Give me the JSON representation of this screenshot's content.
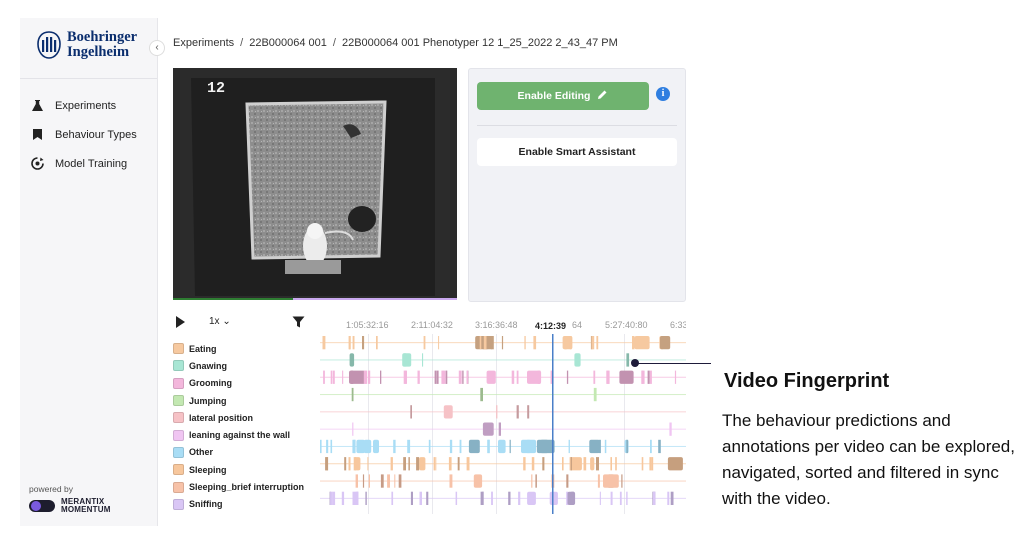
{
  "brand": {
    "name": "Boehringer Ingelheim",
    "line1": "Boehringer",
    "line2": "Ingelheim",
    "color": "#0b2e6e"
  },
  "sidebar": {
    "items": [
      {
        "label": "Experiments",
        "icon": "flask-icon"
      },
      {
        "label": "Behaviour Types",
        "icon": "bookmark-icon"
      },
      {
        "label": "Model Training",
        "icon": "model-training-icon"
      }
    ],
    "powered_by": "powered by",
    "partner": {
      "line1": "MERANTIX",
      "line2": "MOMENTUM"
    }
  },
  "breadcrumb": [
    "Experiments",
    "22B000064 001",
    "22B000064 001 Phenotyper 12 1_25_2022 2_43_47 PM"
  ],
  "video": {
    "overlay_label": "12"
  },
  "panel": {
    "enable_editing": "Enable Editing",
    "enable_smart_assistant": "Enable Smart Assistant",
    "accent": "#6fb36f",
    "info_color": "#2f7ee0"
  },
  "player": {
    "speed": "1x",
    "current_time": "4:12:39",
    "timeline_ticks": [
      "1:05:32:16",
      "2:11:04:32",
      "3:16:36:48",
      "64",
      "5:27:40:80",
      "6:33"
    ]
  },
  "behaviours": [
    {
      "label": "Eating",
      "color": "#f6c9a0"
    },
    {
      "label": "Gnawing",
      "color": "#a8e6d4"
    },
    {
      "label": "Grooming",
      "color": "#f3b7dc"
    },
    {
      "label": "Jumping",
      "color": "#c3e8b2"
    },
    {
      "label": "lateral position",
      "color": "#f6c2c6"
    },
    {
      "label": "leaning against the wall",
      "color": "#f0c5f2"
    },
    {
      "label": "Other",
      "color": "#a9ddf5"
    },
    {
      "label": "Sleeping",
      "color": "#f7c79d"
    },
    {
      "label": "Sleeping_brief interruption",
      "color": "#f7c2a8"
    },
    {
      "label": "Sniffing",
      "color": "#d9c6f5"
    }
  ],
  "annotation": {
    "title": "Video Fingerprint",
    "body": "The behaviour predictions and annotations per video can be explored, navigated, sorted and filtered in sync with the video."
  }
}
